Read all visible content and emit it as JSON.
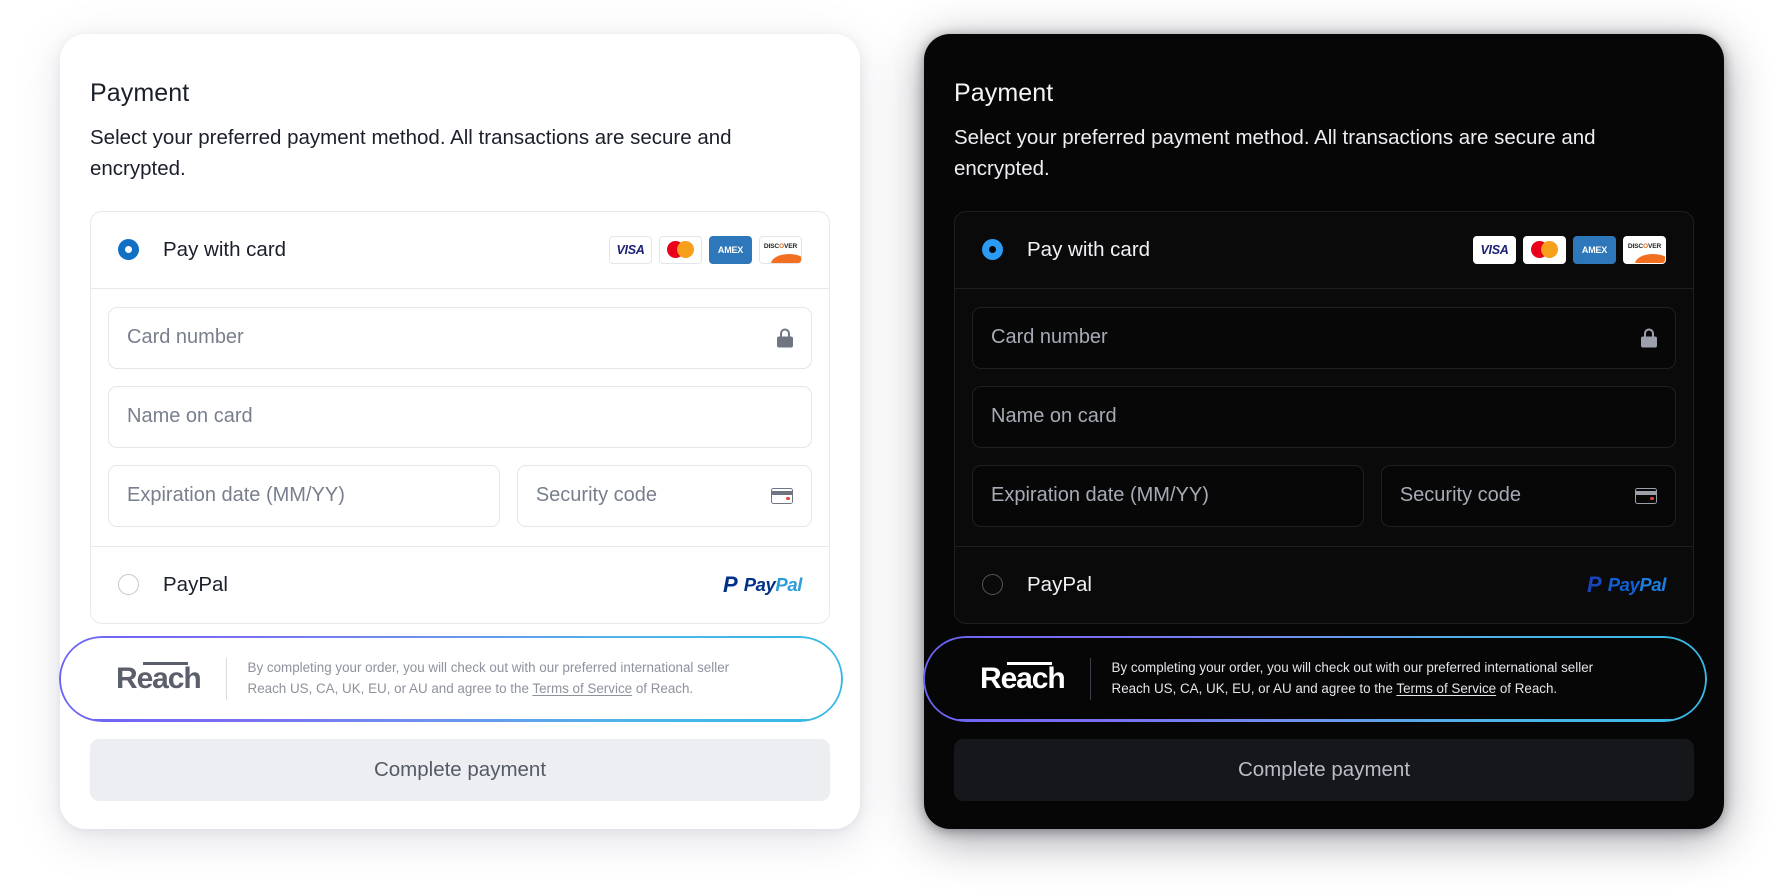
{
  "page": {
    "background": "#ffffff"
  },
  "panels": [
    {
      "theme": "light",
      "accent": "#1170c4",
      "title": "Payment",
      "subtitle": "Select your preferred payment method. All transactions are secure and encrypted.",
      "methods": {
        "card": {
          "label": "Pay with card",
          "selected": true,
          "brands": [
            "VISA",
            "mastercard",
            "AMEX",
            "DISCOVER"
          ]
        },
        "paypal": {
          "label": "PayPal",
          "selected": false,
          "logo_first": "Pay",
          "logo_second": "Pal",
          "logo_glyph": "P"
        }
      },
      "fields": {
        "card_number": {
          "placeholder": "Card number",
          "value": "",
          "icon": "lock-icon"
        },
        "name_on_card": {
          "placeholder": "Name on card",
          "value": ""
        },
        "expiration": {
          "placeholder": "Expiration date (MM/YY)",
          "value": ""
        },
        "security_code": {
          "placeholder": "Security code",
          "value": "",
          "icon": "credit-card-icon"
        }
      },
      "reach": {
        "logo": "Reach",
        "line1": "By completing your order, you will check out with our preferred international seller",
        "line2_before": "Reach US, CA, UK, EU, or AU and agree to the ",
        "line2_link": "Terms of Service",
        "line2_after": " of Reach."
      },
      "submit_label": "Complete payment"
    },
    {
      "theme": "dark",
      "accent": "#2b9bf3",
      "title": "Payment",
      "subtitle": "Select your preferred payment method. All transactions are secure and encrypted.",
      "methods": {
        "card": {
          "label": "Pay with card",
          "selected": true,
          "brands": [
            "VISA",
            "mastercard",
            "AMEX",
            "DISCOVER"
          ]
        },
        "paypal": {
          "label": "PayPal",
          "selected": false,
          "logo_first": "Pay",
          "logo_second": "Pal",
          "logo_glyph": "P"
        }
      },
      "fields": {
        "card_number": {
          "placeholder": "Card number",
          "value": "",
          "icon": "lock-icon"
        },
        "name_on_card": {
          "placeholder": "Name on card",
          "value": ""
        },
        "expiration": {
          "placeholder": "Expiration date (MM/YY)",
          "value": ""
        },
        "security_code": {
          "placeholder": "Security code",
          "value": "",
          "icon": "credit-card-icon"
        }
      },
      "reach": {
        "logo": "Reach",
        "line1": "By completing your order, you will check out with our preferred international seller",
        "line2_before": "Reach US, CA, UK, EU, or AU and agree to the ",
        "line2_link": "Terms of Service",
        "line2_after": " of Reach."
      },
      "submit_label": "Complete payment"
    }
  ],
  "brand_text": {
    "visa": "VISA",
    "amex": "AMEX",
    "discover_pre": "DISC",
    "discover_o": "O",
    "discover_post": "VER"
  },
  "focus_ring": {
    "gradient_start": "#6c63f5",
    "gradient_end": "#37b9e6"
  }
}
